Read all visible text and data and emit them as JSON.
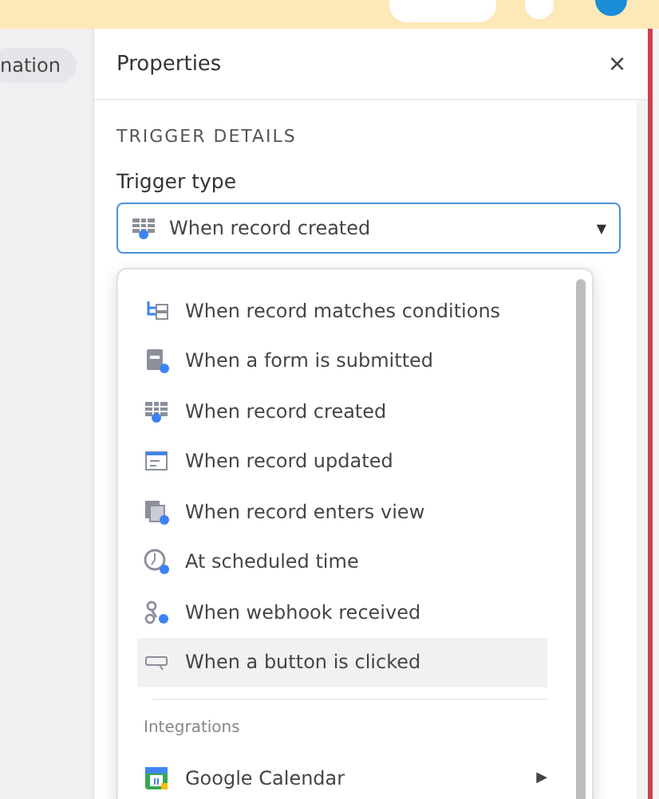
{
  "left_pane": {
    "chip": "nation"
  },
  "panel": {
    "title": "Properties",
    "close": "×",
    "section": "TRIGGER DETAILS",
    "field_label": "Trigger type",
    "select": {
      "value": "When record created",
      "kind": "created",
      "caret": "▼"
    }
  },
  "dropdown": {
    "items": [
      {
        "label": "When record matches conditions",
        "kind": "conditions",
        "hovered": false
      },
      {
        "label": "When a form is submitted",
        "kind": "form",
        "hovered": false
      },
      {
        "label": "When record created",
        "kind": "created",
        "hovered": false
      },
      {
        "label": "When record updated",
        "kind": "updated",
        "hovered": false
      },
      {
        "label": "When record enters view",
        "kind": "view",
        "hovered": false
      },
      {
        "label": "At scheduled time",
        "kind": "schedule",
        "hovered": false
      },
      {
        "label": "When webhook received",
        "kind": "webhook",
        "hovered": false
      },
      {
        "label": "When a button is clicked",
        "kind": "button",
        "hovered": true
      }
    ],
    "group_label": "Integrations",
    "integrations": [
      {
        "label": "Google Calendar",
        "kind": "calendar",
        "arrow": "▶"
      }
    ]
  }
}
